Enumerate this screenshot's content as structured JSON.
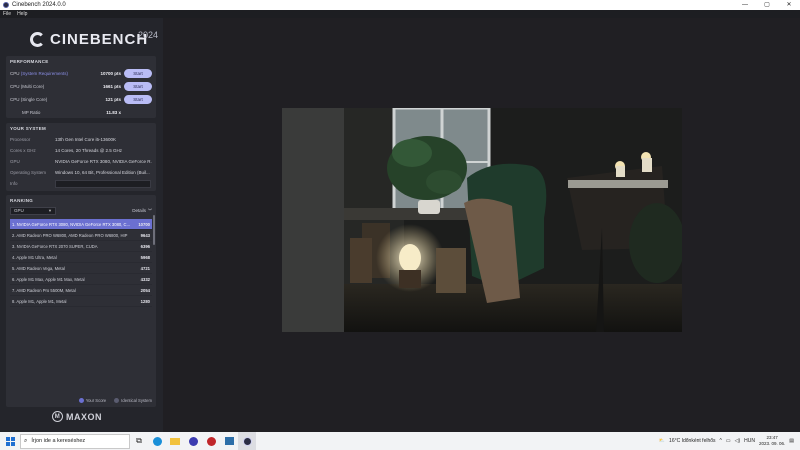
{
  "window": {
    "title": "Cinebench 2024.0.0",
    "controls": [
      "—",
      "▢",
      "✕"
    ]
  },
  "menu": [
    "File",
    "Help"
  ],
  "logo": {
    "brand": "CINEBENCH",
    "year": "2024"
  },
  "performance": {
    "title": "PERFORMANCE",
    "rows": [
      {
        "label": "CPU ",
        "highlight": "(System Requirements)",
        "score": "10700 pts",
        "button": "Start"
      },
      {
        "label": "CPU (Multi Core)",
        "highlight": "",
        "score": "1661 pts",
        "button": "Start"
      },
      {
        "label": "CPU (Single Core)",
        "highlight": "",
        "score": "121 pts",
        "button": "Start"
      },
      {
        "label": "MP Ratio",
        "highlight": "",
        "score": "11.83 x",
        "button": ""
      }
    ]
  },
  "system": {
    "title": "YOUR SYSTEM",
    "rows": [
      {
        "key": "Processor",
        "value": "13th Gen Intel Core i5-13600K"
      },
      {
        "key": "Cores x GHz",
        "value": "14 Cores, 20 Threads @ 2.5 GHz"
      },
      {
        "key": "GPU",
        "value": "NVIDIA GeForce RTX 3080, NVIDIA GeForce R..."
      },
      {
        "key": "Operating System",
        "value": "Windows 10, 64 Bit, Professional Edition (Buil..."
      },
      {
        "key": "Info",
        "value": ""
      }
    ]
  },
  "ranking": {
    "title": "RANKING",
    "select": "GPU",
    "details": "Details",
    "rows": [
      {
        "name": "1. NVIDIA GeForce RTX 3080, NVIDIA GeForce RTX 3080, C...",
        "value": "10700",
        "active": true
      },
      {
        "name": "2. AMD Radeon PRO W6800, AMD Radeon PRO W6800, HIP",
        "value": "9643",
        "active": false
      },
      {
        "name": "3. NVIDIA GeForce RTX 2070 SUPER, CUDA",
        "value": "6396",
        "active": false
      },
      {
        "name": "4. Apple M1 Ultra, Metal",
        "value": "5968",
        "active": false
      },
      {
        "name": "5. AMD Radeon Vega, Metal",
        "value": "4721",
        "active": false
      },
      {
        "name": "6. Apple M1 Max, Apple M1 Max, Metal",
        "value": "4332",
        "active": false
      },
      {
        "name": "7. AMD Radeon Pro 5500M, Metal",
        "value": "2054",
        "active": false
      },
      {
        "name": "8. Apple M1, Apple M1, Metal",
        "value": "1280",
        "active": false
      }
    ],
    "legend": {
      "your_score": "Your Score",
      "identical": "Identical System"
    },
    "colors": {
      "active": "#6b70d1",
      "your_score_dot": "#6b70d1",
      "identical_dot": "#5a5c70"
    }
  },
  "footer": {
    "brand": "MAXON"
  },
  "taskbar": {
    "search_placeholder": "Írjon ide a kereséshez",
    "weather": "16°C  Időnként felhős",
    "lang": "HUN",
    "time": "23:47",
    "date": "2023. 09. 06."
  }
}
